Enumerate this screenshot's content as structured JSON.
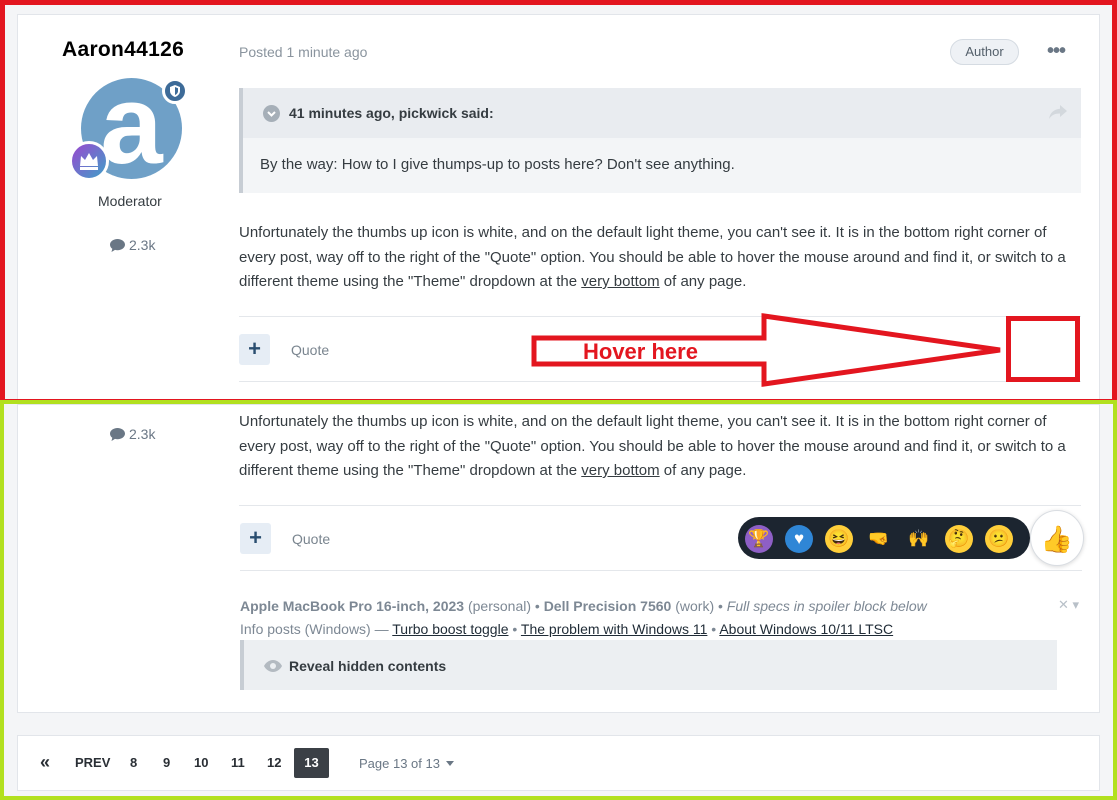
{
  "post": {
    "author": "Aaron44126",
    "avatar_letter": "a",
    "role": "Moderator",
    "post_count": "2.3k",
    "posted": "Posted 1 minute ago",
    "author_badge": "Author",
    "more_menu": "•••",
    "quote": {
      "attribution": "41 minutes ago, pickwick said:",
      "text": "By the way: How to I give thumps-up to posts here? Don't see anything."
    },
    "body": {
      "part1": "Unfortunately the thumbs up icon is white, and on the default light theme, you can't see it. It is in the bottom right corner of every post, way off to the right of the \"Quote\" option. You should be able to hover the mouse around and find it, or switch to a different theme using the \"Theme\" dropdown at the ",
      "link": "very bottom",
      "part2": " of any page."
    },
    "plus_label": "+",
    "quote_label": "Quote"
  },
  "annotation": {
    "label": "Hover here",
    "color": "#e3161f"
  },
  "second_post": {
    "post_count": "2.3k",
    "plus_label": "+",
    "quote_label": "Quote",
    "reactions": [
      {
        "icon": "trophy-icon",
        "glyph": "🏆"
      },
      {
        "icon": "heart-icon",
        "glyph": "♥"
      },
      {
        "icon": "laughing-face-icon",
        "glyph": "😆"
      },
      {
        "icon": "fist-bump-icon",
        "glyph": "🤜"
      },
      {
        "icon": "raised-hands-icon",
        "glyph": "🙌"
      },
      {
        "icon": "thinking-face-icon",
        "glyph": "🤔"
      },
      {
        "icon": "confused-face-icon",
        "glyph": "😕"
      }
    ],
    "thumbs_up": "👍",
    "signature": {
      "laptop": "Apple MacBook Pro 16-inch, 2023",
      "laptop_note": "(personal)",
      "sep1": " • ",
      "workstation": "Dell Precision 7560",
      "workstation_note": "(work)",
      "sep2": " • ",
      "specs_note": "Full specs in spoiler block below",
      "info_prefix": "Info posts (Windows) — ",
      "link1": "Turbo boost toggle",
      "sep3": " • ",
      "link2": "The problem with Windows 11",
      "sep4": " • ",
      "link3": "About Windows 10/11 LTSC",
      "close_label": "✕ ▾"
    },
    "spoiler_label": "Reveal hidden contents"
  },
  "pagination": {
    "first": "«",
    "prev": "PREV",
    "pages": [
      "8",
      "9",
      "10",
      "11",
      "12"
    ],
    "current": "13",
    "jump": "Page 13 of 13"
  },
  "colors": {
    "red_frame": "#e3161f",
    "green_frame": "#b2e01f",
    "avatar_bg": "#6fa0c7"
  }
}
